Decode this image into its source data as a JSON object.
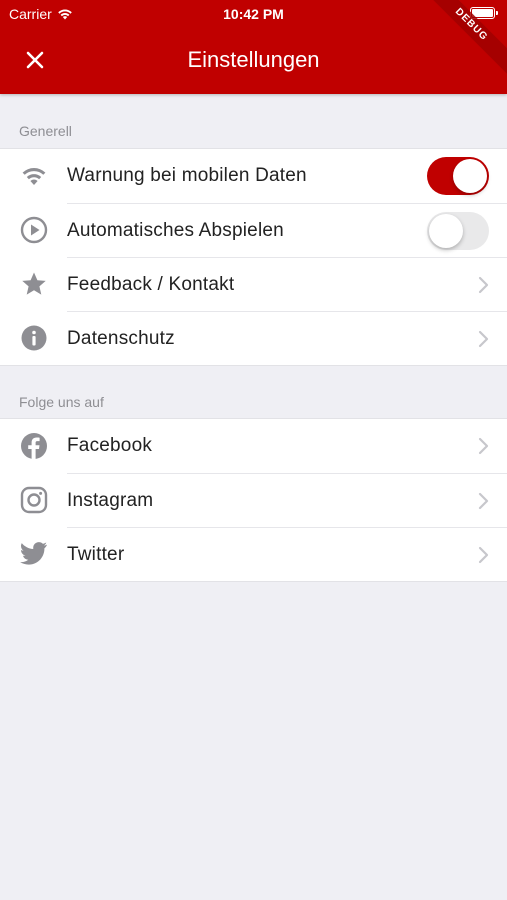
{
  "statusbar": {
    "carrier": "Carrier",
    "time": "10:42 PM"
  },
  "appbar": {
    "title": "Einstellungen",
    "debug_banner": "DEBUG",
    "accent": "#c00000"
  },
  "general": {
    "header": "Generell",
    "items": [
      {
        "label": "Warnung bei mobilen Daten",
        "icon": "wifi-icon",
        "toggle": true
      },
      {
        "label": "Automatisches Abspielen",
        "icon": "play-circle-icon",
        "toggle": false
      },
      {
        "label": "Feedback / Kontakt",
        "icon": "star-icon"
      },
      {
        "label": "Datenschutz",
        "icon": "info-icon"
      }
    ]
  },
  "social": {
    "header": "Folge uns auf",
    "items": [
      {
        "label": "Facebook",
        "icon": "facebook-icon"
      },
      {
        "label": "Instagram",
        "icon": "instagram-icon"
      },
      {
        "label": "Twitter",
        "icon": "twitter-icon"
      }
    ]
  }
}
